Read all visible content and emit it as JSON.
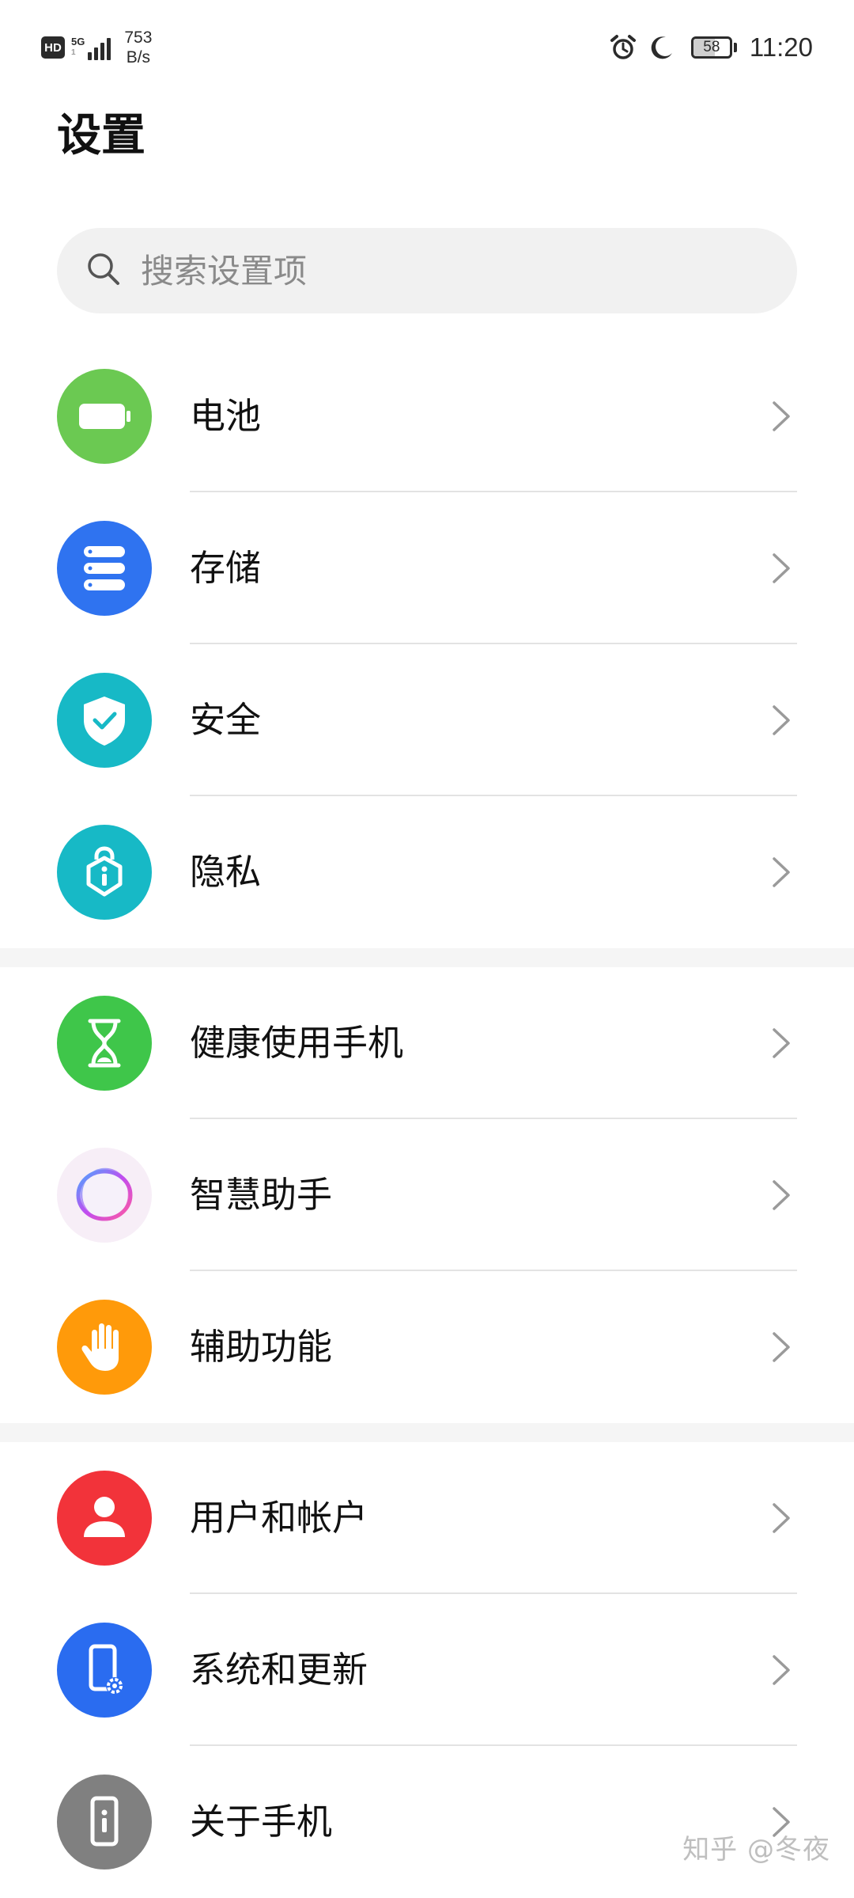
{
  "status_bar": {
    "hd": "HD",
    "network_type": "5G",
    "network_sub": "1",
    "net_speed_value": "753",
    "net_speed_unit": "B/s",
    "battery_level": "58",
    "battery_fraction": 0.58,
    "time": "11:20",
    "icons": [
      "alarm-icon",
      "moon-icon",
      "battery-icon"
    ]
  },
  "page": {
    "title": "设置"
  },
  "search": {
    "placeholder": "搜索设置项",
    "value": ""
  },
  "groups": [
    {
      "items": [
        {
          "label": "电池",
          "icon": "battery-icon",
          "color": "#6bc952"
        },
        {
          "label": "存储",
          "icon": "storage-icon",
          "color": "#2f73f0"
        },
        {
          "label": "安全",
          "icon": "shield-check-icon",
          "color": "#17b9c6"
        },
        {
          "label": "隐私",
          "icon": "privacy-lock-icon",
          "color": "#17b9c6"
        }
      ]
    },
    {
      "items": [
        {
          "label": "健康使用手机",
          "icon": "hourglass-icon",
          "color": "#3fc64a"
        },
        {
          "label": "智慧助手",
          "icon": "assistant-orb-icon",
          "color": "#f7eef7"
        },
        {
          "label": "辅助功能",
          "icon": "hand-icon",
          "color": "#ff9a0a"
        }
      ]
    },
    {
      "items": [
        {
          "label": "用户和帐户",
          "icon": "user-icon",
          "color": "#f2333a"
        },
        {
          "label": "系统和更新",
          "icon": "phone-settings-icon",
          "color": "#2a6cf0"
        },
        {
          "label": "关于手机",
          "icon": "phone-info-icon",
          "color": "#808080"
        }
      ]
    }
  ],
  "watermark": "知乎 @冬夜"
}
